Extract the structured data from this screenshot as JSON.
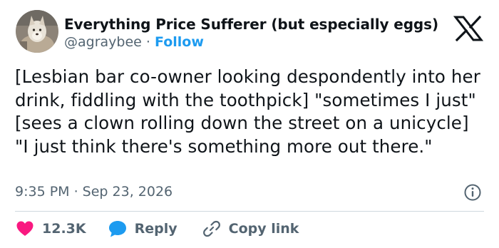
{
  "author": {
    "display_name": "Everything Price Sufferer (but especially eggs)",
    "handle": "@agraybee",
    "separator": "·",
    "follow_label": "Follow"
  },
  "tweet": {
    "text": "[Lesbian bar co-owner looking despondently into her drink, fiddling with the toothpick] \"sometimes I just\" [sees a clown rolling down the street on a unicycle] \"I just think there's something more out there.\"",
    "timestamp": "9:35 PM · Sep 23, 2026"
  },
  "actions": {
    "like_count": "12.3K",
    "reply_label": "Reply",
    "copy_link_label": "Copy link"
  },
  "icons": {
    "brand": "x-logo-icon",
    "like": "heart-icon",
    "reply": "speech-bubble-icon",
    "copy": "link-icon",
    "info": "info-icon"
  },
  "colors": {
    "text": "#0f1419",
    "muted": "#536471",
    "accent": "#1d9bf0",
    "like": "#f91880",
    "divider": "#cfd9de"
  }
}
